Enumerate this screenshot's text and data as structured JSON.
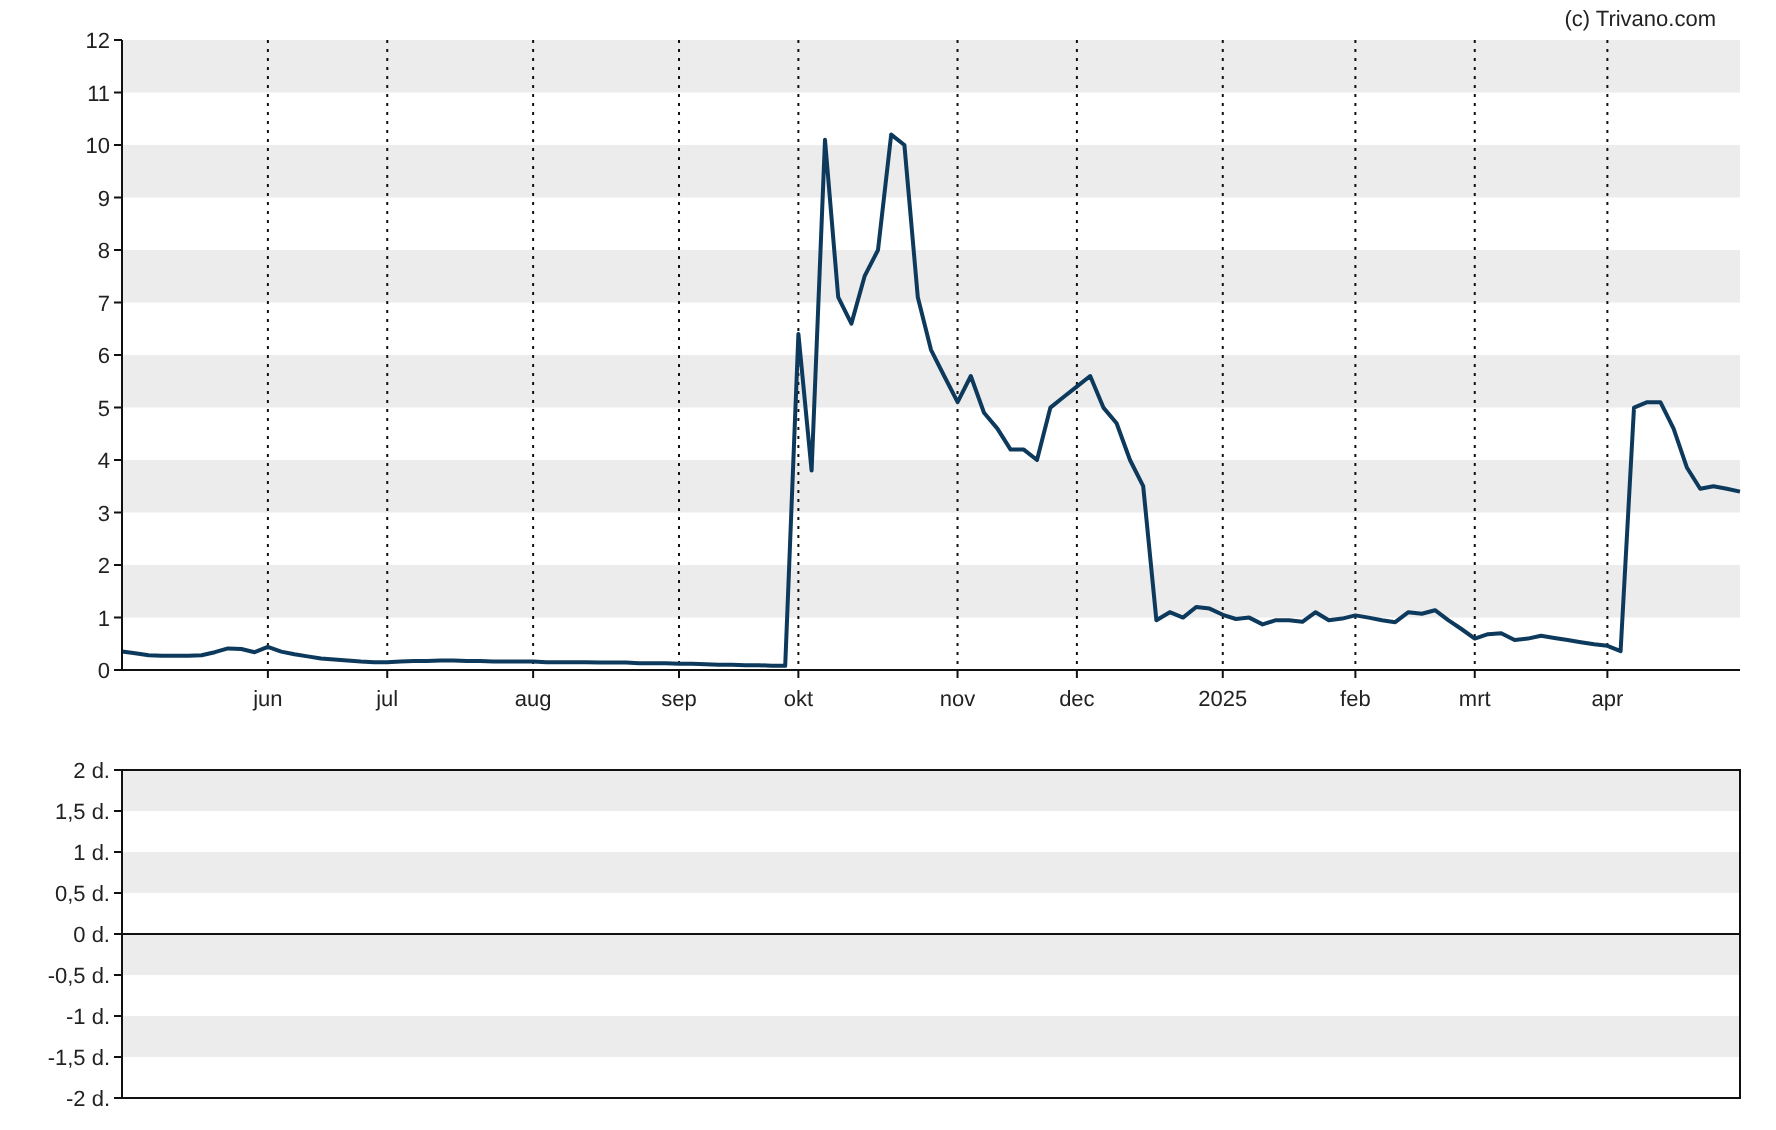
{
  "credit": "(c) Trivano.com",
  "price_chart": {
    "chart_data": {
      "type": "line",
      "grid": true,
      "ylim": [
        0,
        12
      ],
      "yticks": [
        0,
        1,
        2,
        3,
        4,
        5,
        6,
        7,
        8,
        9,
        10,
        11,
        12
      ],
      "categories": [
        null,
        null,
        null,
        null,
        null,
        null,
        null,
        null,
        null,
        null,
        null,
        "jun",
        null,
        null,
        null,
        null,
        null,
        null,
        null,
        null,
        "jul",
        null,
        null,
        null,
        null,
        null,
        null,
        null,
        null,
        null,
        null,
        "aug",
        null,
        null,
        null,
        null,
        null,
        null,
        null,
        null,
        null,
        null,
        "sep",
        null,
        null,
        null,
        null,
        null,
        null,
        null,
        null,
        "okt",
        null,
        null,
        null,
        null,
        null,
        null,
        null,
        null,
        null,
        null,
        null,
        "nov",
        null,
        null,
        null,
        null,
        null,
        null,
        null,
        null,
        "dec",
        null,
        null,
        null,
        null,
        null,
        null,
        null,
        null,
        null,
        null,
        "2025",
        null,
        null,
        null,
        null,
        null,
        null,
        null,
        null,
        null,
        "feb",
        null,
        null,
        null,
        null,
        null,
        null,
        null,
        null,
        "mrt",
        null,
        null,
        null,
        null,
        null,
        null,
        null,
        null,
        null,
        "apr",
        null,
        null,
        null,
        null,
        null,
        null,
        null,
        null,
        null,
        null
      ],
      "series": [
        {
          "color": "#0d3a5c",
          "values": [
            0.35,
            0.32,
            0.28,
            0.27,
            0.27,
            0.27,
            0.28,
            0.34,
            0.41,
            0.4,
            0.34,
            0.44,
            0.35,
            0.3,
            0.26,
            0.22,
            0.2,
            0.18,
            0.16,
            0.15,
            0.15,
            0.16,
            0.17,
            0.17,
            0.18,
            0.18,
            0.17,
            0.17,
            0.16,
            0.16,
            0.16,
            0.16,
            0.15,
            0.15,
            0.15,
            0.15,
            0.14,
            0.14,
            0.14,
            0.13,
            0.13,
            0.13,
            0.12,
            0.12,
            0.11,
            0.1,
            0.1,
            0.09,
            0.09,
            0.08,
            0.08,
            6.4,
            3.8,
            10.1,
            7.1,
            6.6,
            7.5,
            8.0,
            10.2,
            10.0,
            7.1,
            6.1,
            5.6,
            5.1,
            5.6,
            4.9,
            4.6,
            4.2,
            4.2,
            4.0,
            5.0,
            5.2,
            5.4,
            5.6,
            5.0,
            4.7,
            4.0,
            3.5,
            0.95,
            1.1,
            1.0,
            1.2,
            1.17,
            1.05,
            0.97,
            1.0,
            0.87,
            0.95,
            0.95,
            0.92,
            1.1,
            0.95,
            0.98,
            1.04,
            1.0,
            0.95,
            0.91,
            1.1,
            1.07,
            1.14,
            0.95,
            0.78,
            0.6,
            0.68,
            0.7,
            0.57,
            0.6,
            0.65,
            0.61,
            0.57,
            0.53,
            0.49,
            0.46,
            0.36,
            5.0,
            5.1,
            5.1,
            4.6,
            3.85,
            3.45,
            3.5,
            3.45,
            3.4
          ]
        }
      ]
    }
  },
  "dividend_panel": {
    "y_axis_labels": [
      "2 d.",
      "1,5 d.",
      "1 d.",
      "0,5 d.",
      "0 d.",
      "-0,5 d.",
      "-1 d.",
      "-1,5 d.",
      "-2 d."
    ]
  }
}
